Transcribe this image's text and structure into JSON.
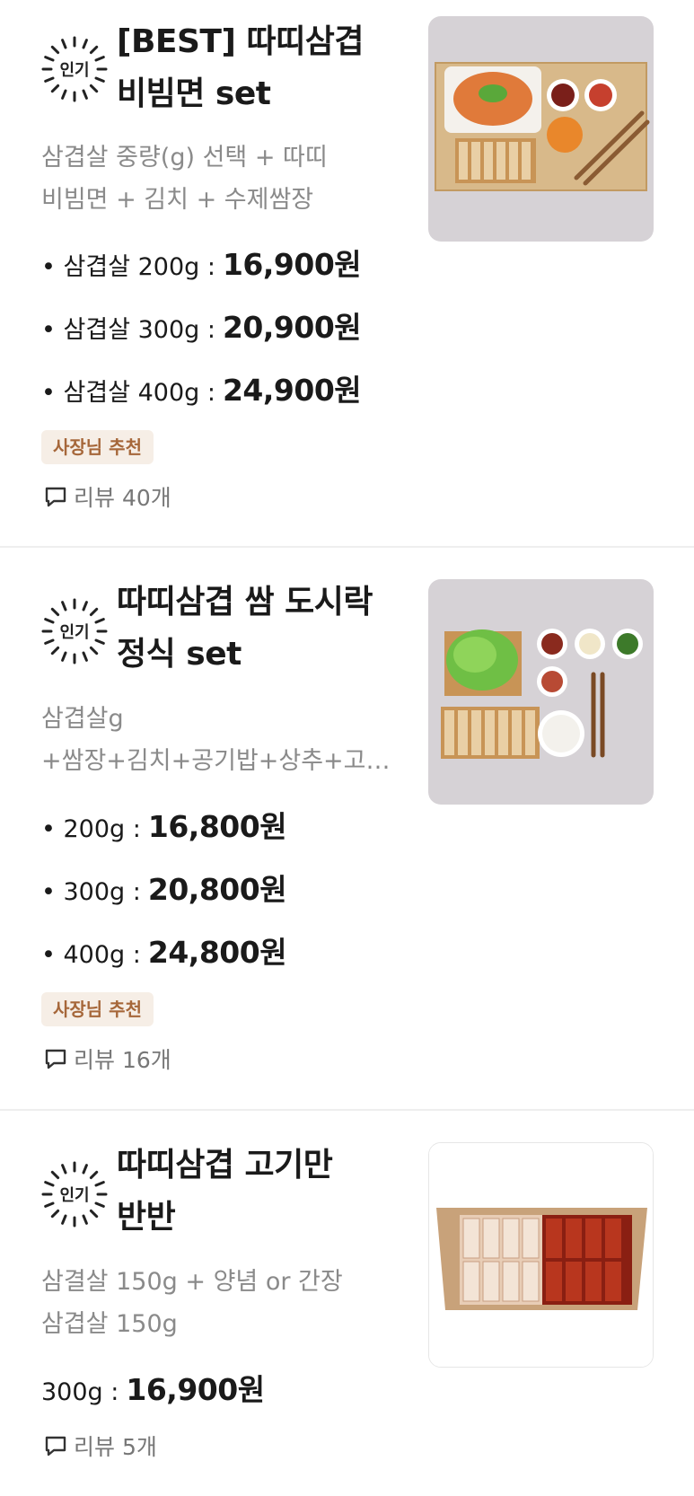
{
  "badge_text": "인기",
  "recommend_label": "사장님 추천",
  "colors": {
    "accent_text": "#a6673a",
    "accent_bg": "#f6eee6",
    "muted": "#8a8a8a"
  },
  "items": [
    {
      "title_line1": "[BEST] 따띠삼겹",
      "title_line2": "비빔면  set",
      "desc_line1": "삼겹살 중량(g) 선택 + 따띠",
      "desc_line2": "비빔면 + 김치 + 수제쌈장",
      "prices": [
        {
          "label": "• 삼겹살 200g :",
          "amount": "16,900원"
        },
        {
          "label": "• 삼겹살 300g :",
          "amount": "20,900원"
        },
        {
          "label": "• 삼겹살 400g :",
          "amount": "24,900원"
        }
      ],
      "recommended": true,
      "review": "리뷰 40개",
      "image_icon": "bibimmyeon-set-photo"
    },
    {
      "title_line1": "따띠삼겹 쌈 도시락",
      "title_line2": "정식 set",
      "desc_line1": "삼겹살g",
      "desc_line2": "+쌈장+김치+공기밥+상추+고추...",
      "prices": [
        {
          "label": "• 200g :",
          "amount": "16,800원"
        },
        {
          "label": "• 300g :",
          "amount": "20,800원"
        },
        {
          "label": "• 400g :",
          "amount": "24,800원"
        }
      ],
      "recommended": true,
      "review": "리뷰 16개",
      "image_icon": "ssam-dosirak-set-photo"
    },
    {
      "title_line1": "따띠삼겹 고기만",
      "title_line2": "반반",
      "desc_line1": "삼결살 150g + 양념 or 간장",
      "desc_line2": "삼겹살 150g",
      "prices": [
        {
          "label": "300g :",
          "amount": "16,900원"
        }
      ],
      "recommended": false,
      "review": "리뷰 5개",
      "image_icon": "meat-banban-photo"
    }
  ]
}
